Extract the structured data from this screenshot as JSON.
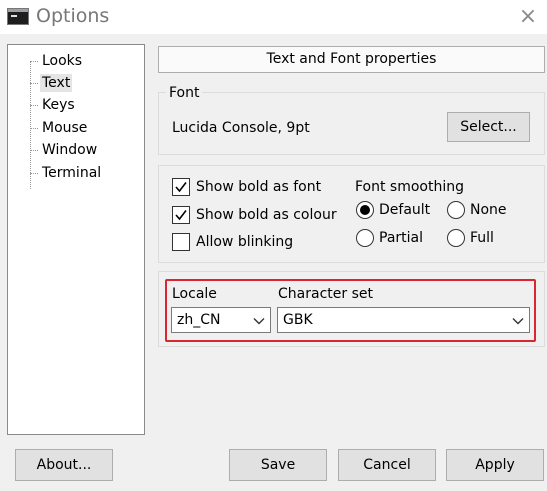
{
  "window": {
    "title": "Options",
    "icon": "terminal-icon",
    "close": "×"
  },
  "tree": {
    "items": [
      {
        "label": "Looks"
      },
      {
        "label": "Text",
        "selected": true
      },
      {
        "label": "Keys"
      },
      {
        "label": "Mouse"
      },
      {
        "label": "Window"
      },
      {
        "label": "Terminal"
      }
    ]
  },
  "header": {
    "title": "Text and Font properties"
  },
  "font": {
    "group_label": "Font",
    "current": "Lucida Console, 9pt",
    "select_label": "Select..."
  },
  "options": {
    "show_bold_font": {
      "label": "Show bold as font",
      "checked": true
    },
    "show_bold_colour": {
      "label": "Show bold as colour",
      "checked": true
    },
    "allow_blinking": {
      "label": "Allow blinking",
      "checked": false
    },
    "font_smoothing": {
      "label": "Font smoothing",
      "selected": "Default",
      "choices": [
        "Default",
        "None",
        "Partial",
        "Full"
      ]
    }
  },
  "locale": {
    "locale_label": "Locale",
    "locale_value": "zh_CN",
    "charset_label": "Character set",
    "charset_value": "GBK"
  },
  "footer": {
    "about": "About...",
    "save": "Save",
    "cancel": "Cancel",
    "apply": "Apply"
  },
  "colors": {
    "highlight": "#d9262f",
    "background": "#f0f0f0"
  }
}
